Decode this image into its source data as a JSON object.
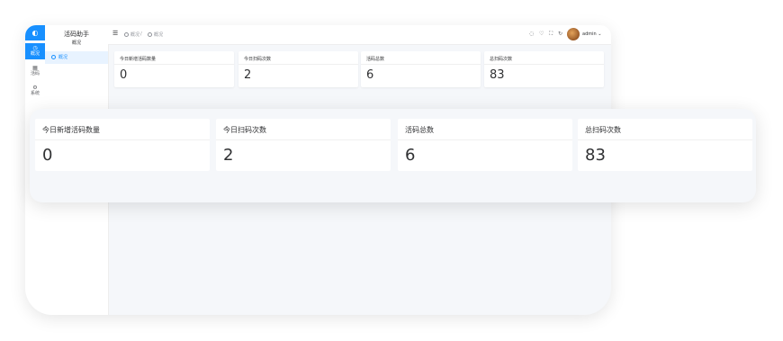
{
  "app": {
    "title": "活码助手",
    "subtitle": "概况"
  },
  "rail": {
    "logo_glyph": "◐",
    "items": [
      {
        "label": "概况",
        "icon": "clock-icon",
        "glyph": "◷",
        "active": true
      },
      {
        "label": "活码",
        "icon": "qrcode-icon",
        "glyph": "▦",
        "active": false
      },
      {
        "label": "系统",
        "icon": "gear-icon",
        "glyph": "⚙",
        "active": false
      }
    ]
  },
  "submenu": {
    "items": [
      {
        "label": "概况",
        "active": true
      }
    ]
  },
  "topbar": {
    "menu_glyph": "☰",
    "breadcrumb": [
      "概况",
      "概况"
    ],
    "breadcrumb_separator": "/",
    "tools": [
      {
        "icon": "notification-icon",
        "glyph": "◌"
      },
      {
        "icon": "theme-icon",
        "glyph": "♡"
      },
      {
        "icon": "fullscreen-icon",
        "glyph": "⛶"
      },
      {
        "icon": "refresh-icon",
        "glyph": "↻"
      }
    ],
    "user": {
      "name": "admin",
      "caret": "⌄"
    }
  },
  "stats": [
    {
      "label": "今日新增活码数量",
      "value": "0"
    },
    {
      "label": "今日扫码次数",
      "value": "2"
    },
    {
      "label": "活码总数",
      "value": "6"
    },
    {
      "label": "总扫码次数",
      "value": "83"
    }
  ]
}
